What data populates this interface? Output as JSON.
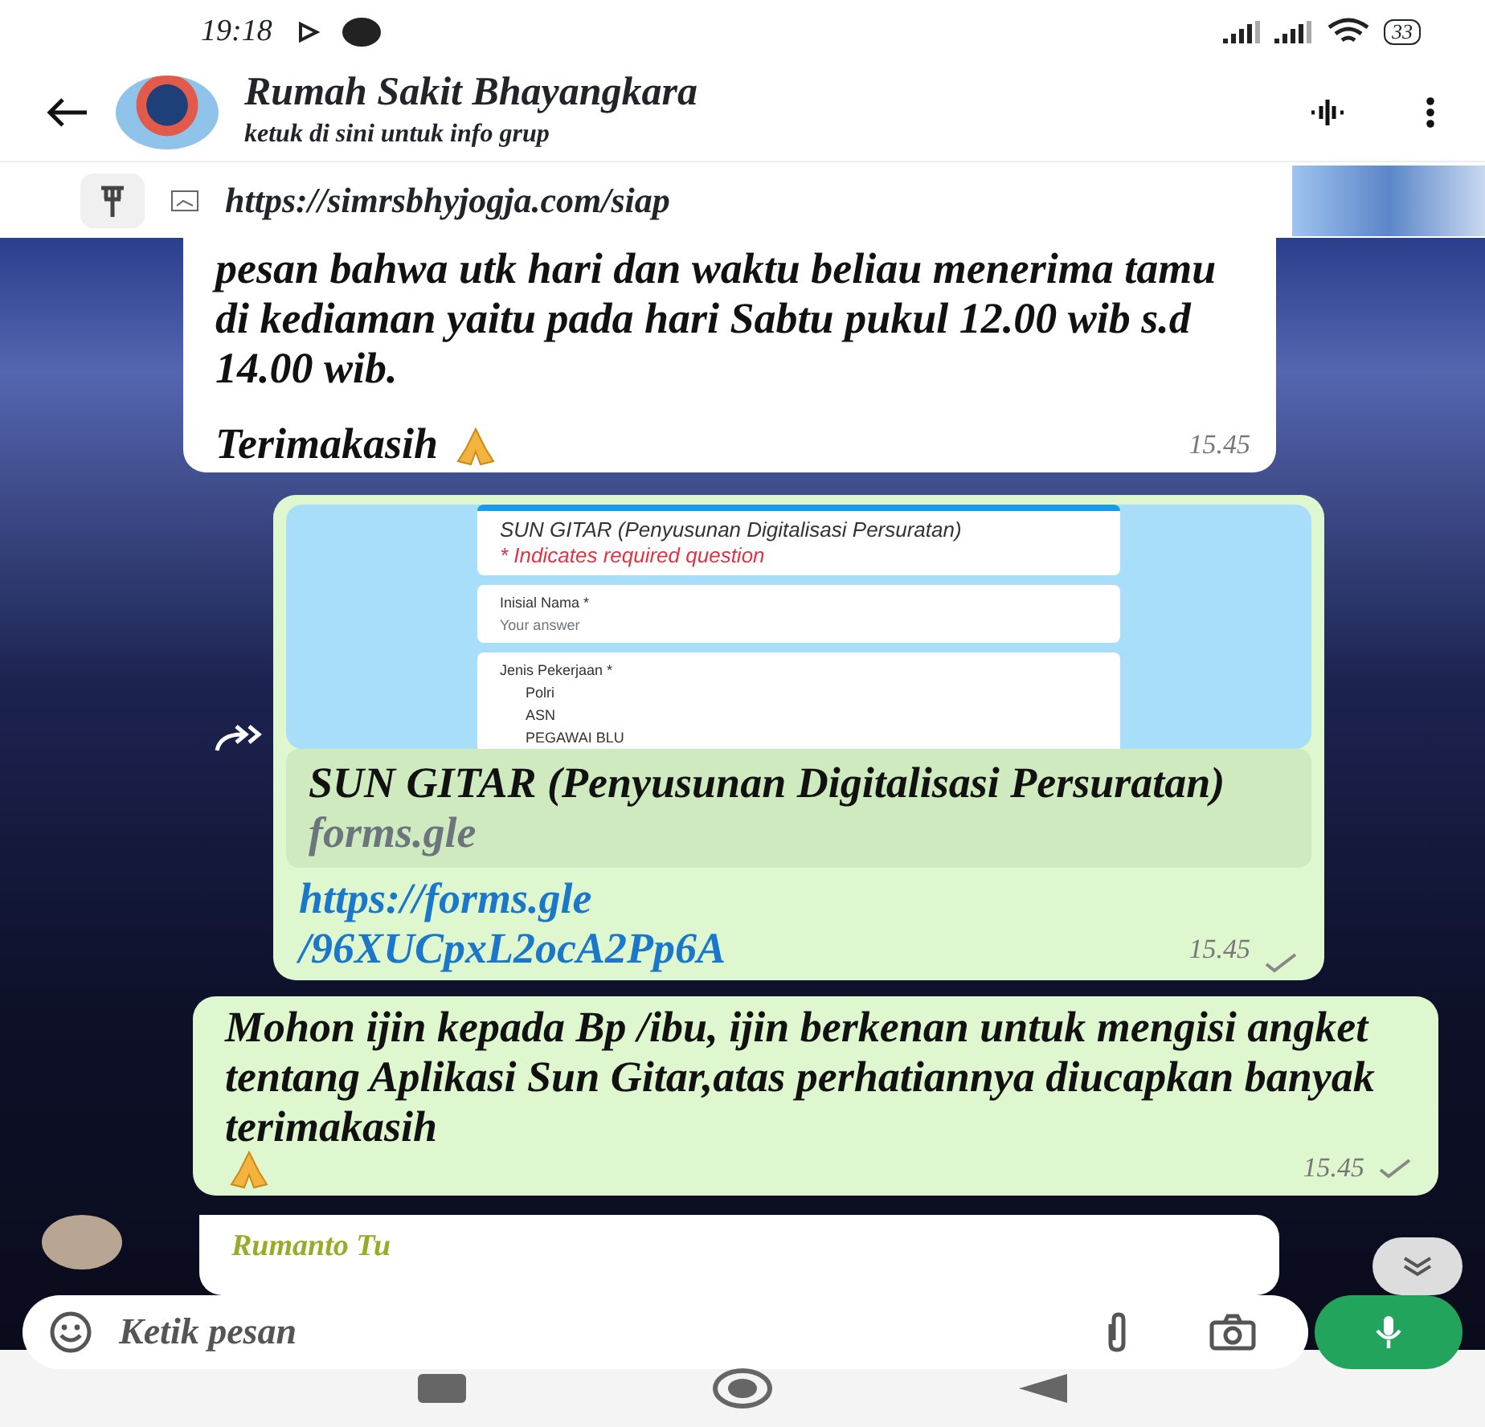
{
  "status_bar": {
    "time": "19:18",
    "battery": "33"
  },
  "header": {
    "title": "Rumah Sakit Bhayangkara",
    "subtitle": "ketuk di sini untuk info grup"
  },
  "pinned": {
    "text": "https://simrsbhyjogja.com/siap"
  },
  "messages": [
    {
      "kind": "text",
      "outgoing": false,
      "forwarded": false,
      "text": "pesan bahwa utk hari dan waktu beliau menerima tamu di kediaman yaitu pada hari Sabtu pukul 12.00 wib s.d 14.00 wib.",
      "closing": "Terimakasih",
      "time": "15.45"
    },
    {
      "kind": "link",
      "outgoing": true,
      "forwarded": true,
      "preview": {
        "title": "SUN GITAR (Penyusunan Digitalisasi Persuratan)",
        "note": "* Indicates required question",
        "fields": [
          {
            "label": "Inisial Nama *",
            "placeholder": "Your answer"
          },
          {
            "label": "Jenis Pekerjaan *",
            "options": [
              "Polri",
              "ASN",
              "PEGAWAI BLU"
            ]
          }
        ]
      },
      "title": "SUN GITAR (Penyusunan Digitalisasi Persuratan)",
      "domain": "forms.gle",
      "url_lines": [
        "https://forms.gle",
        "/96XUCpxL2ocA2Pp6A"
      ],
      "time": "15.45",
      "sent": true
    },
    {
      "kind": "text",
      "outgoing": true,
      "forwarded": false,
      "text": "Mohon ijin kepada Bp /ibu, ijin berkenan untuk mengisi angket tentang Aplikasi Sun Gitar,atas perhatiannya diucapkan banyak terimakasih",
      "time": "15.45",
      "sent": true
    },
    {
      "kind": "sender",
      "outgoing": false,
      "forwarded": false,
      "sender": "Rumanto Tu"
    }
  ],
  "composer": {
    "placeholder": "Ketik pesan"
  }
}
